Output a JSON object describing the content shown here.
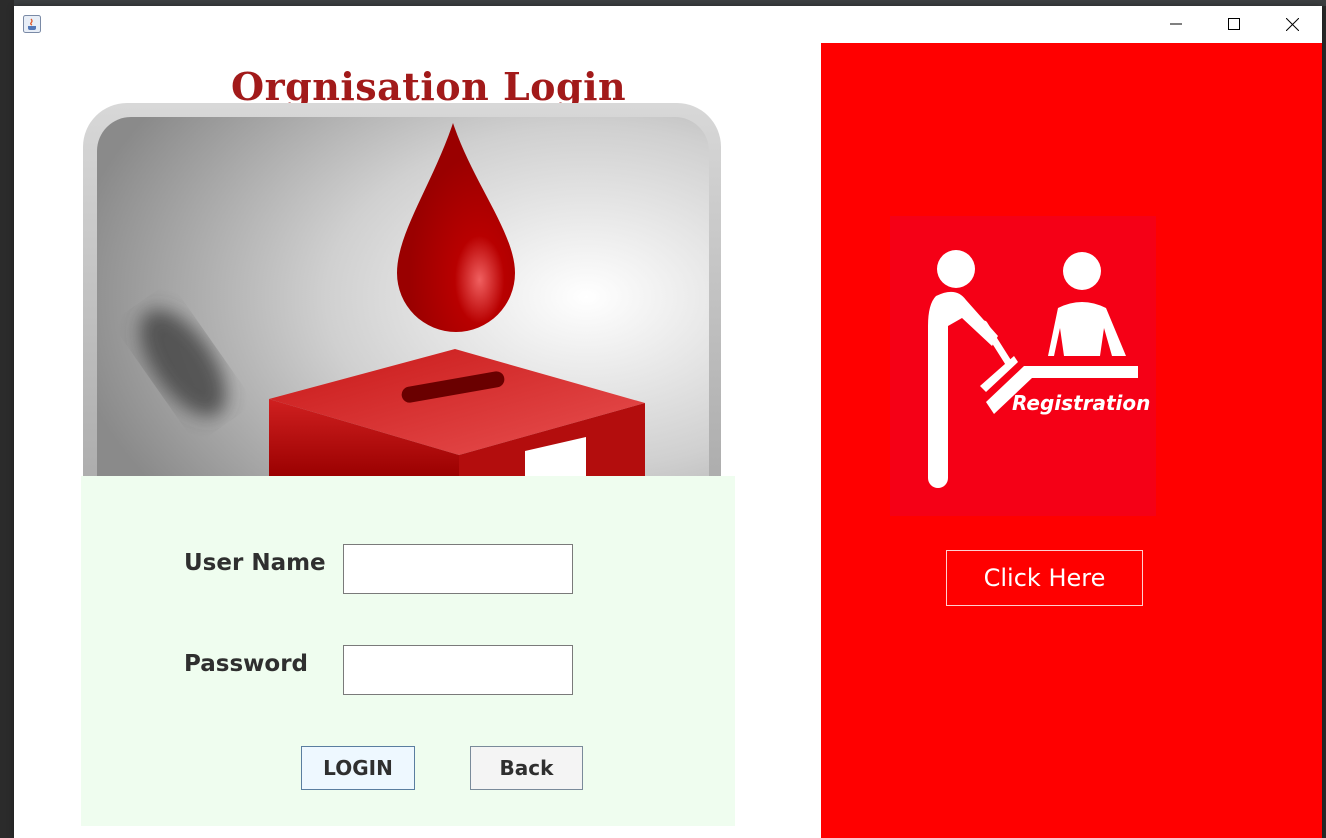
{
  "window": {
    "title": "",
    "controls": {
      "minimize_icon": "minimize-icon",
      "maximize_icon": "maximize-icon",
      "close_icon": "close-icon"
    }
  },
  "login": {
    "title": "Orgnisation Login",
    "hero_icon": "blood-donation-icon",
    "username_label": "User Name",
    "username_value": "",
    "password_label": "Password",
    "password_value": "",
    "login_button": "LOGIN",
    "back_button": "Back"
  },
  "registration": {
    "image_text": "Registration",
    "image_icon": "registration-icon",
    "button_label": "Click Here"
  },
  "colors": {
    "title": "#a21a1a",
    "form_background": "#effdef",
    "registration_background": "#ff0000",
    "blood_red": "#b00000"
  }
}
